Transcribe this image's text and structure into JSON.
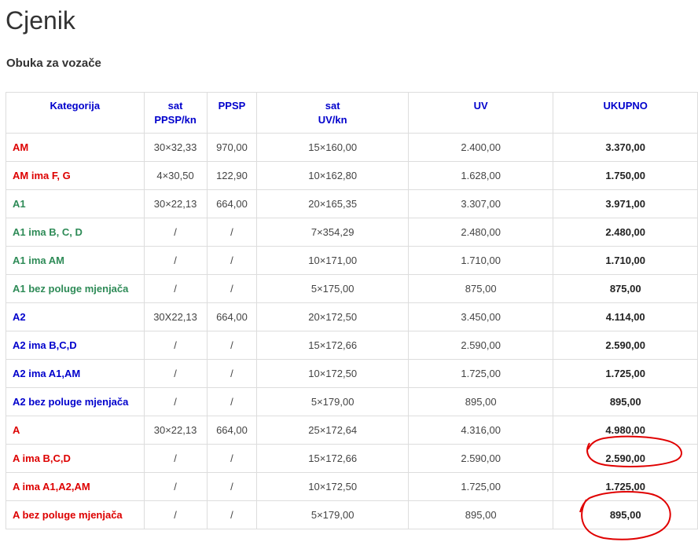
{
  "page": {
    "title": "Cjenik",
    "section_title": "Obuka za vozače"
  },
  "table": {
    "headers": {
      "kategorija": "Kategorija",
      "sat_ppsp_line1": "sat",
      "sat_ppsp_line2": "PPSP/kn",
      "ppsp": "PPSP",
      "sat_uv_line1": "sat",
      "sat_uv_line2": "UV/kn",
      "uv": "UV",
      "ukupno": "UKUPNO"
    },
    "rows": [
      {
        "kategorija": "AM",
        "sat_ppsp": "30×32,33",
        "ppsp": "970,00",
        "sat_uv": "15×160,00",
        "uv": "2.400,00",
        "ukupno": "3.370,00",
        "color": "#dd0000"
      },
      {
        "kategorija": "AM ima F, G",
        "sat_ppsp": "4×30,50",
        "ppsp": "122,90",
        "sat_uv": "10×162,80",
        "uv": "1.628,00",
        "ukupno": "1.750,00",
        "color": "#dd0000"
      },
      {
        "kategorija": "A1",
        "sat_ppsp": "30×22,13",
        "ppsp": "664,00",
        "sat_uv": "20×165,35",
        "uv": "3.307,00",
        "ukupno": "3.971,00",
        "color": "#2e8b57"
      },
      {
        "kategorija": "A1 ima B, C, D",
        "sat_ppsp": "/",
        "ppsp": "/",
        "sat_uv": "7×354,29",
        "uv": "2.480,00",
        "ukupno": "2.480,00",
        "color": "#2e8b57"
      },
      {
        "kategorija": "A1 ima AM",
        "sat_ppsp": "/",
        "ppsp": "/",
        "sat_uv": "10×171,00",
        "uv": "1.710,00",
        "ukupno": "1.710,00",
        "color": "#2e8b57"
      },
      {
        "kategorija": "A1 bez poluge mjenjača",
        "sat_ppsp": "/",
        "ppsp": "/",
        "sat_uv": "5×175,00",
        "uv": "875,00",
        "ukupno": "875,00",
        "color": "#2e8b57"
      },
      {
        "kategorija": "A2",
        "sat_ppsp": "30X22,13",
        "ppsp": "664,00",
        "sat_uv": "20×172,50",
        "uv": "3.450,00",
        "ukupno": "4.114,00",
        "color": "#0000cc"
      },
      {
        "kategorija": "A2 ima B,C,D",
        "sat_ppsp": "/",
        "ppsp": "/",
        "sat_uv": "15×172,66",
        "uv": "2.590,00",
        "ukupno": "2.590,00",
        "color": "#0000cc"
      },
      {
        "kategorija": "A2 ima A1,AM",
        "sat_ppsp": "/",
        "ppsp": "/",
        "sat_uv": "10×172,50",
        "uv": "1.725,00",
        "ukupno": "1.725,00",
        "color": "#0000cc"
      },
      {
        "kategorija": "A2 bez poluge mjenjača",
        "sat_ppsp": "/",
        "ppsp": "/",
        "sat_uv": "5×179,00",
        "uv": "895,00",
        "ukupno": "895,00",
        "color": "#0000cc"
      },
      {
        "kategorija": "A",
        "sat_ppsp": "30×22,13",
        "ppsp": "664,00",
        "sat_uv": "25×172,64",
        "uv": "4.316,00",
        "ukupno": "4.980,00",
        "color": "#dd0000"
      },
      {
        "kategorija": "A ima B,C,D",
        "sat_ppsp": "/",
        "ppsp": "/",
        "sat_uv": "15×172,66",
        "uv": "2.590,00",
        "ukupno": "2.590,00",
        "color": "#dd0000"
      },
      {
        "kategorija": "A ima A1,A2,AM",
        "sat_ppsp": "/",
        "ppsp": "/",
        "sat_uv": "10×172,50",
        "uv": "1.725,00",
        "ukupno": "1.725,00",
        "color": "#dd0000"
      },
      {
        "kategorija": "A bez poluge mjenjača",
        "sat_ppsp": "/",
        "ppsp": "/",
        "sat_uv": "5×179,00",
        "uv": "895,00",
        "ukupno": "895,00",
        "color": "#dd0000"
      }
    ]
  },
  "annotations": {
    "color": "#e00000",
    "circled_rows": [
      "A ima B,C,D",
      "A bez poluge mjenjača"
    ]
  }
}
